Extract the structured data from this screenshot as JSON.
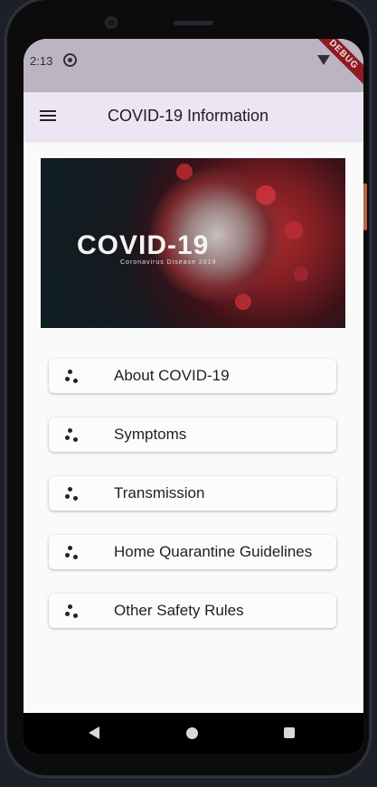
{
  "status_bar": {
    "time": "2:13",
    "debug_label": "DEBUG"
  },
  "app_bar": {
    "title": "COVID-19 Information"
  },
  "hero": {
    "title": "COVID-19",
    "subtitle": "Coronavirus Disease 2019"
  },
  "menu": {
    "items": [
      {
        "label": "About COVID-19"
      },
      {
        "label": "Symptoms"
      },
      {
        "label": "Transmission"
      },
      {
        "label": "Home Quarantine Guidelines"
      },
      {
        "label": "Other Safety Rules"
      }
    ]
  },
  "colors": {
    "status_bar": "#bcb4c3",
    "app_bar": "#ece5f3",
    "background": "#fafafa",
    "debug_banner": "#8e1b22"
  },
  "icons": {
    "menu": "hamburger-menu-icon",
    "item": "scatter-dots-icon",
    "nav_back": "triangle-back-icon",
    "nav_home": "circle-home-icon",
    "nav_recent": "square-recent-icon"
  }
}
